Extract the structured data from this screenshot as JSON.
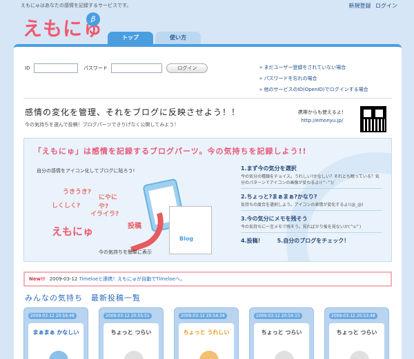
{
  "header": {
    "tagline": "えもにゅはあなたの感情を記録するサービスです。",
    "signup_label": "新規登録",
    "login_label": "ログイン",
    "logo_text": "えもにゅ",
    "beta_label": "β",
    "tabs": [
      {
        "label": "トップ",
        "active": true
      },
      {
        "label": "使い方",
        "active": false
      }
    ]
  },
  "login": {
    "id_label": "ID",
    "id_value": "",
    "password_label": "パスワード",
    "password_value": "",
    "button_label": "ログイン"
  },
  "help_links": [
    "» まだユーザー登録をされていない場合",
    "» パスワードを忘れの場合",
    "» 他のサービスのID(OpenID)でログインする場合"
  ],
  "intro": {
    "headline": "感情の変化を管理、それをブログに反映させよう！！",
    "subline": "今の気持ちを選んで投稿！ブログパーツできりげなく公開してみよう！",
    "mobile_label": "携帯からも使えるよ！",
    "mobile_url": "http://emonyu.jp/"
  },
  "banner": {
    "title": "「えもにゅ」は感情を記録するブログパーツ。今の気持ちを記録しよう!!",
    "subtitle": "自分の感情をアイコン化してブログに貼ろう!",
    "bubbles": [
      "うきうき?",
      "にやにや?",
      "しくしく?",
      "イライラ?"
    ],
    "logo_small": "えもにゅ",
    "post_label": "投稿",
    "blog_label": "Blog",
    "caption": "今の気持ちを簡単に表示",
    "steps": [
      {
        "title": "1.まず今の気分を選択",
        "desc": "今の気分の種類をチョイス。うれしい?かなしい？それとも眠っている？気分のパターンでアイコンの画像が変わるよ!(^-^)/"
      },
      {
        "title": "2.ちょっと?まぁまぁ?かなり?",
        "desc": "気持ちの度合を選択しよう。アイコンの表情が変化するよ!(@_@)"
      },
      {
        "title": "3.今の気分にメモを残そう",
        "desc": "今の気持ちに一言メモで残そう。見ればかり後を見ないか(^o^)"
      }
    ],
    "step4": "4.投稿！",
    "step5": "5.自分のブログをチェック！"
  },
  "news": {
    "badge": "New!!",
    "date": "2009-03-12",
    "message": "Timeloeと連携！えもにゅが自動でTimeloeへ。"
  },
  "recent": {
    "title": "みんなの気持ち　最新投稿一覧",
    "posts": [
      {
        "timestamp": "2009-03-12 20:59:48",
        "mood": "まぁまぁ かなしい",
        "color": "blue"
      },
      {
        "timestamp": "2009-03-12 20:55:51",
        "mood": "ちょっと つらい",
        "color": "gray"
      },
      {
        "timestamp": "2009-03-12 20:54:34",
        "mood": "ちょっと うれしい",
        "color": "orange"
      },
      {
        "timestamp": "2009-03-12 20:54:15",
        "mood": "ちょっと つらい",
        "color": "gray"
      },
      {
        "timestamp": "2009-03-12 20:53:48",
        "mood": "ちょっと つらい",
        "color": "gray"
      }
    ]
  }
}
